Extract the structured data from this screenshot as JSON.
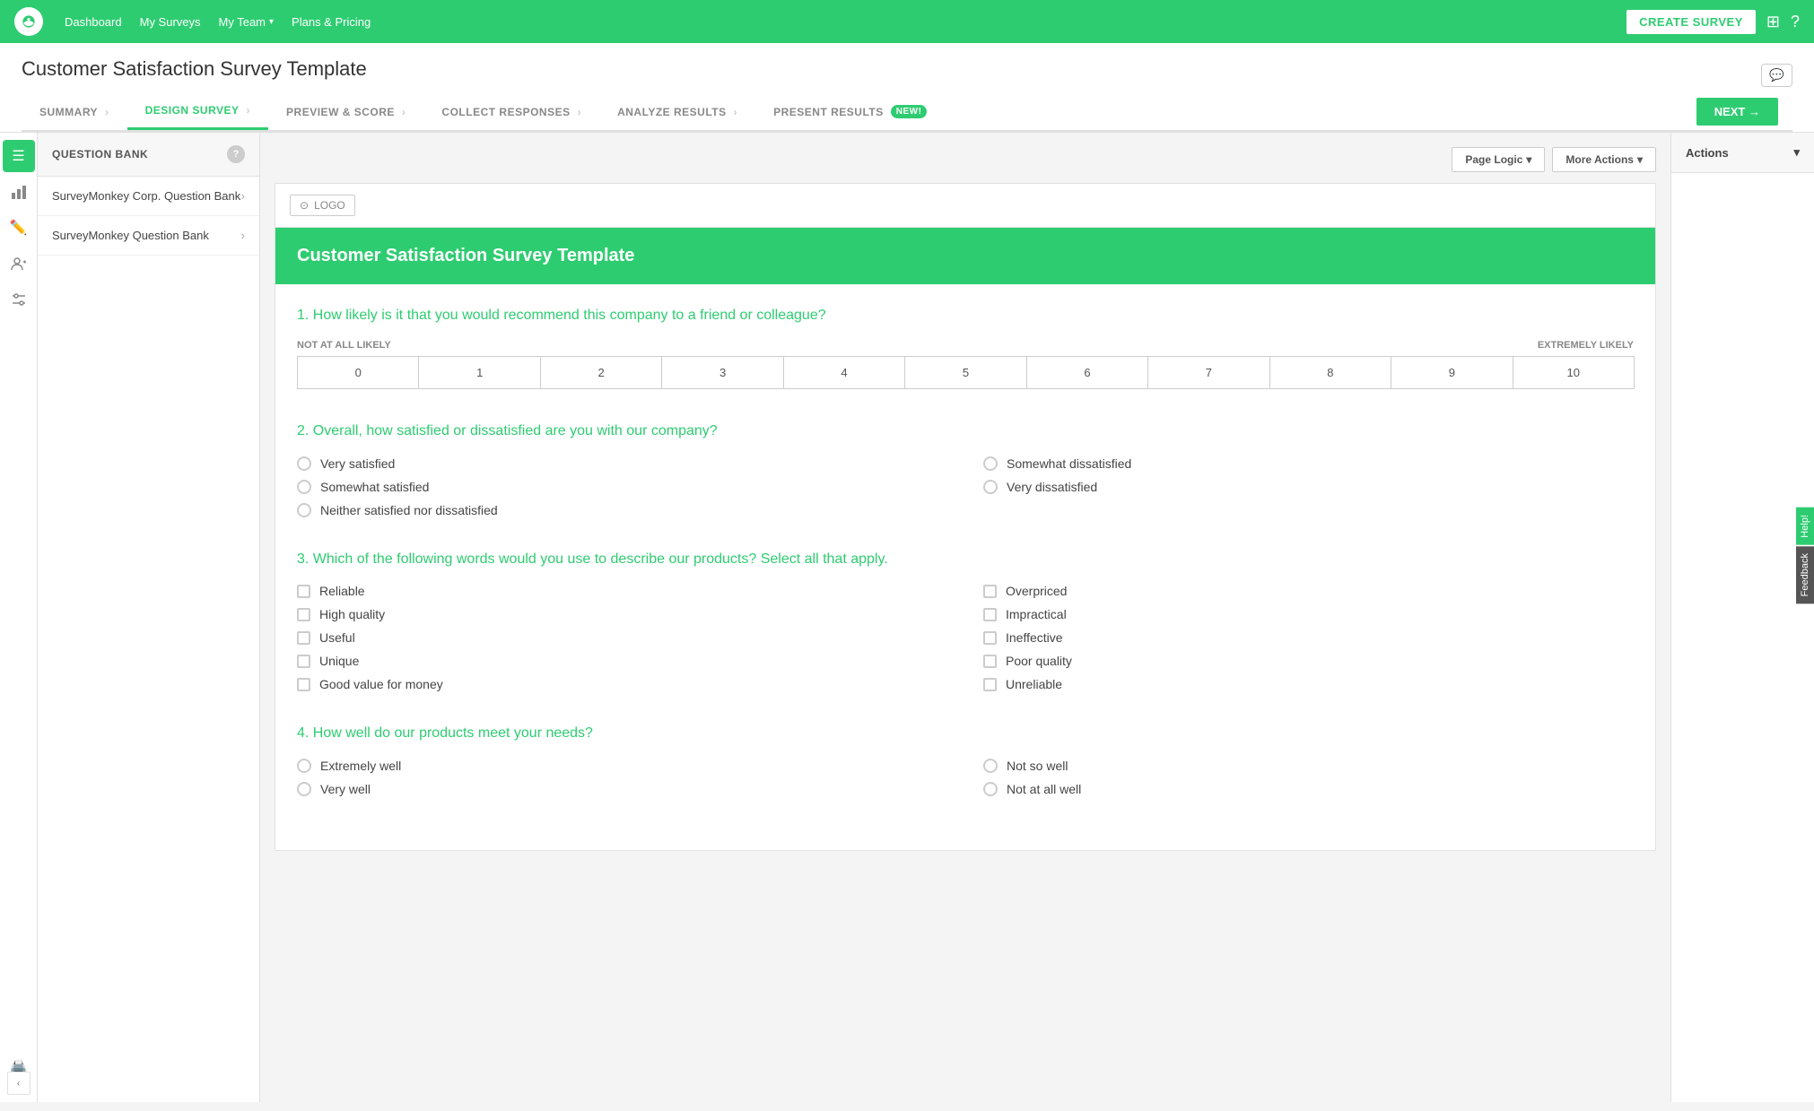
{
  "nav": {
    "logo_alt": "SurveyMonkey Logo",
    "links": [
      "Dashboard",
      "My Surveys",
      "My Team",
      "Plans & Pricing"
    ],
    "my_team_has_dropdown": true,
    "create_survey_label": "CREATE SURVEY",
    "help_icon": "?"
  },
  "page": {
    "title": "Customer Satisfaction Survey Template",
    "comment_icon": "💬"
  },
  "tabs": [
    {
      "id": "summary",
      "label": "SUMMARY",
      "active": false
    },
    {
      "id": "design-survey",
      "label": "DESIGN SURVEY",
      "active": true
    },
    {
      "id": "preview-score",
      "label": "PREVIEW & SCORE",
      "active": false
    },
    {
      "id": "collect-responses",
      "label": "COLLECT RESPONSES",
      "active": false
    },
    {
      "id": "analyze-results",
      "label": "ANALYZE RESULTS",
      "active": false
    },
    {
      "id": "present-results",
      "label": "PRESENT RESULTS",
      "active": false,
      "badge": "NEW!"
    }
  ],
  "next_button": "NEXT →",
  "sidebar_icons": [
    {
      "id": "question-bank",
      "icon": "☰",
      "active": true
    },
    {
      "id": "analytics",
      "icon": "📊",
      "active": false
    },
    {
      "id": "edit",
      "icon": "✏️",
      "active": false
    },
    {
      "id": "add-users",
      "icon": "👥",
      "active": false
    },
    {
      "id": "sliders",
      "icon": "⚙️",
      "active": false
    }
  ],
  "question_bank": {
    "title": "QUESTION BANK",
    "help_label": "?",
    "items": [
      {
        "label": "SurveyMonkey Corp. Question Bank"
      },
      {
        "label": "SurveyMonkey Question Bank"
      }
    ]
  },
  "toolbar": {
    "page_logic_label": "Page Logic",
    "more_actions_label": "More Actions",
    "actions_label": "Actions"
  },
  "survey": {
    "logo_label": "LOGO",
    "header_title": "Customer Satisfaction Survey Template",
    "questions": [
      {
        "id": 1,
        "text": "1. How likely is it that you would recommend this company to a friend or colleague?",
        "type": "nps",
        "nps_min_label": "NOT AT ALL LIKELY",
        "nps_max_label": "EXTREMELY LIKELY",
        "nps_values": [
          "0",
          "1",
          "2",
          "3",
          "4",
          "5",
          "6",
          "7",
          "8",
          "9",
          "10"
        ]
      },
      {
        "id": 2,
        "text": "2. Overall, how satisfied or dissatisfied are you with our company?",
        "type": "radio",
        "options": [
          [
            "Very satisfied",
            "Somewhat dissatisfied"
          ],
          [
            "Somewhat satisfied",
            "Very dissatisfied"
          ],
          [
            "Neither satisfied nor dissatisfied",
            ""
          ]
        ]
      },
      {
        "id": 3,
        "text": "3. Which of the following words would you use to describe our products? Select all that apply.",
        "type": "checkbox",
        "options": [
          [
            "Reliable",
            "Overpriced"
          ],
          [
            "High quality",
            "Impractical"
          ],
          [
            "Useful",
            "Ineffective"
          ],
          [
            "Unique",
            "Poor quality"
          ],
          [
            "Good value for money",
            "Unreliable"
          ]
        ]
      },
      {
        "id": 4,
        "text": "4. How well do our products meet your needs?",
        "type": "radio",
        "options": [
          [
            "Extremely well",
            "Not so well"
          ],
          [
            "Very well",
            "Not at all well"
          ]
        ]
      }
    ]
  },
  "right_edge": {
    "help_label": "Help!",
    "feedback_label": "Feedback"
  },
  "print_icon": "🖨️",
  "collapse_icon": "‹"
}
